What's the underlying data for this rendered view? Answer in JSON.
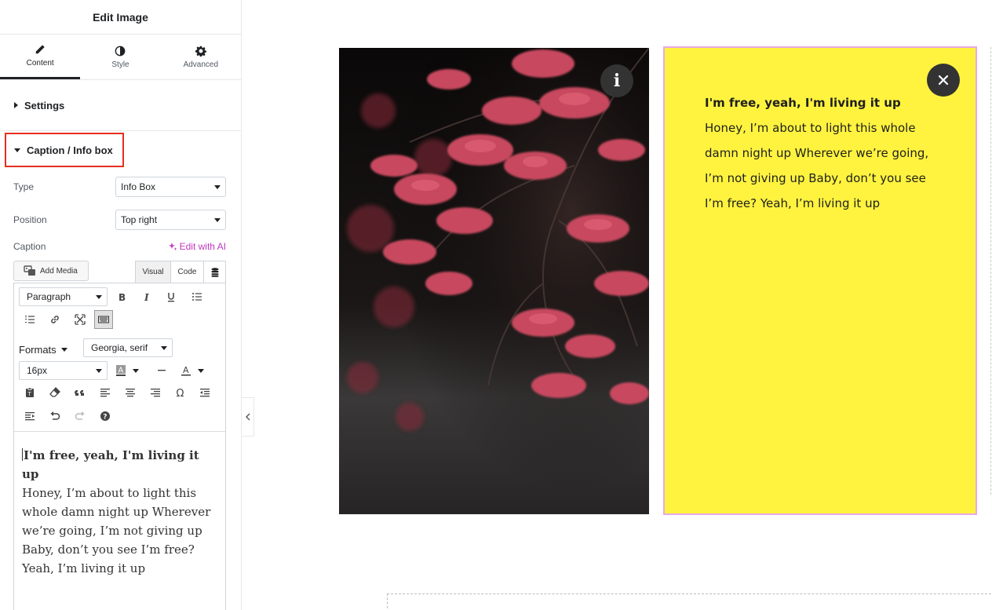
{
  "panel": {
    "title": "Edit Image",
    "tabs": [
      {
        "label": "Content",
        "icon": "pencil-icon",
        "active": true
      },
      {
        "label": "Style",
        "icon": "half-circle-icon",
        "active": false
      },
      {
        "label": "Advanced",
        "icon": "gear-icon",
        "active": false
      }
    ],
    "sections": {
      "settings": "Settings",
      "caption_info": "Caption / Info box"
    },
    "controls": {
      "type_label": "Type",
      "type_value": "Info Box",
      "position_label": "Position",
      "position_value": "Top right",
      "caption_label": "Caption",
      "edit_ai": "Edit with AI"
    },
    "editor": {
      "add_media": "Add Media",
      "visual_tab": "Visual",
      "code_tab": "Code",
      "paragraph": "Paragraph",
      "formats": "Formats",
      "font_family": "Georgia, serif",
      "font_size": "16px",
      "content_bold": "I'm free, yeah, I'm living it up",
      "content_body": "Honey, I’m about to light this whole damn night up Wherever we’re going, I’m not giving up Baby, don’t you see I’m free? Yeah, I’m living it up"
    }
  },
  "canvas": {
    "info_icon": "i",
    "infobox": {
      "bold_line": "I'm free, yeah, I'm living it up",
      "lines": [
        "Honey, I’m about to light this whole",
        "damn night up Wherever we’re going,",
        "I’m not giving up Baby, don’t you see",
        "I’m free? Yeah, I’m living it up"
      ],
      "background": "#fff33f",
      "border": "#e7a9e7"
    }
  },
  "colors": {
    "highlight_border": "#e62e1f",
    "ai_accent": "#c036c0",
    "dark_button": "#333333"
  }
}
